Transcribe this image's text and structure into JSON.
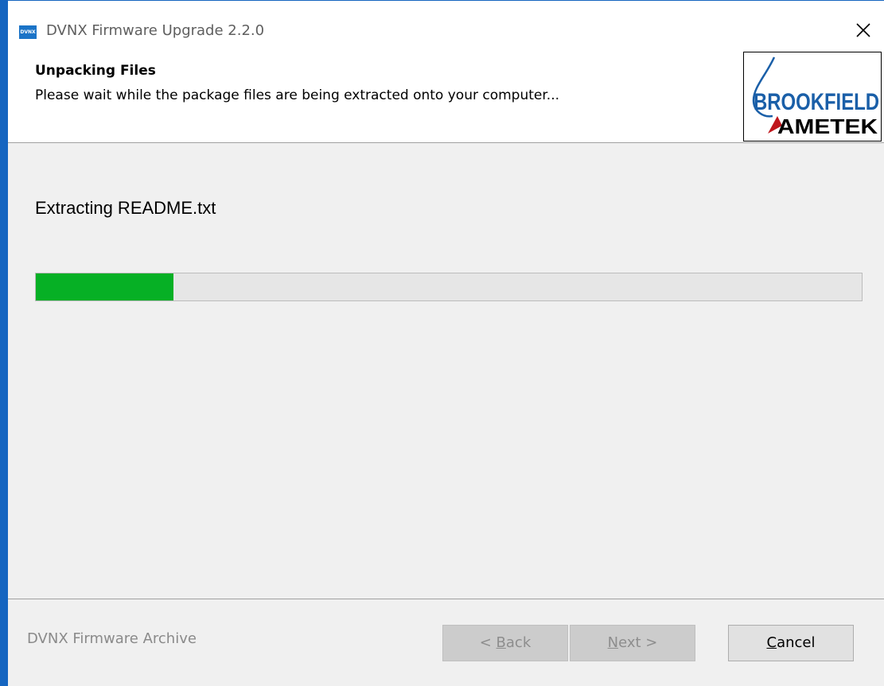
{
  "window": {
    "title": "DVNX Firmware Upgrade 2.2.0",
    "icon_label": "DVNX",
    "close_glyph": "✕"
  },
  "header": {
    "title": "Unpacking Files",
    "subtitle": "Please wait while the package files are being extracted onto your computer...",
    "logo": {
      "brand_top": "BROOKFIELD",
      "brand_bottom": "AMETEK"
    }
  },
  "main": {
    "status": "Extracting README.txt",
    "progress_fraction": 0.167
  },
  "footer": {
    "label": "DVNX Firmware Archive",
    "buttons": {
      "back": {
        "prefix": "< ",
        "mnemonic": "B",
        "rest": "ack",
        "enabled": false
      },
      "next": {
        "prefix": "",
        "mnemonic": "N",
        "rest": "ext >",
        "enabled": false
      },
      "cancel": {
        "prefix": "",
        "mnemonic": "C",
        "rest": "ancel",
        "enabled": true
      }
    }
  },
  "colors": {
    "accent_border": "#1565c0",
    "progress_fill": "#06b025",
    "logo_blue": "#1a5fa8",
    "logo_red": "#c0161c"
  }
}
